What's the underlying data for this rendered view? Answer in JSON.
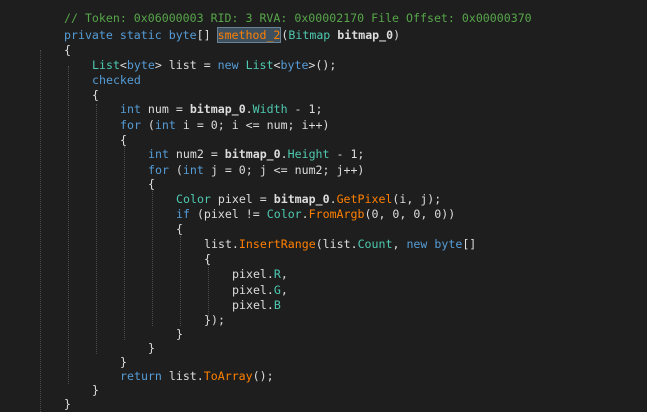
{
  "comment": "// Token: 0x06000003 RID: 3 RVA: 0x00002170 File Offset: 0x00000370",
  "sig": {
    "mods": "private static",
    "ret": "byte",
    "brackets": "[] ",
    "name": "smethod_2",
    "open": "(",
    "ptype": "Bitmap",
    "pname": "bitmap_0",
    "close": ")"
  },
  "b": {
    "open": "{",
    "close": "}",
    "close_paren": "});"
  },
  "l_list": {
    "t1": "List",
    "t2": "<",
    "t3": "byte",
    "t4": "> list = ",
    "k": "new",
    "t5": " ",
    "t6": "List",
    "t7": "<",
    "t8": "byte",
    "t9": ">();"
  },
  "checked": "checked",
  "l_num": {
    "k": "int",
    "a": " num = ",
    "p": "bitmap_0",
    "dot": ".",
    "prop": "Width",
    "rest": " - 1;"
  },
  "for1": {
    "k": "for",
    "a": " (",
    "k2": "int",
    "rest": " i = 0; i <= num; i++)"
  },
  "l_num2": {
    "k": "int",
    "a": " num2 = ",
    "p": "bitmap_0",
    "dot": ".",
    "prop": "Height",
    "rest": " - 1;"
  },
  "for2": {
    "k": "for",
    "a": " (",
    "k2": "int",
    "rest": " j = 0; j <= num2; j++)"
  },
  "l_pixel": {
    "t": "Color",
    "a": " pixel = ",
    "p": "bitmap_0",
    "dot": ".",
    "m": "GetPixel",
    "rest": "(i, j);"
  },
  "l_if": {
    "k": "if",
    "a": " (pixel != ",
    "t": "Color",
    "dot": ".",
    "m": "FromArgb",
    "rest": "(0, 0, 0, 0))"
  },
  "l_insert": {
    "a": "list.",
    "m": "InsertRange",
    "b": "(list.",
    "prop": "Count",
    "c": ", ",
    "k": "new",
    "d": " ",
    "k2": "byte",
    "e": "[]"
  },
  "l_r": {
    "a": "pixel.",
    "prop": "R",
    "c": ","
  },
  "l_g": {
    "a": "pixel.",
    "prop": "G",
    "c": ","
  },
  "l_bb": {
    "a": "pixel.",
    "prop": "B"
  },
  "l_return": {
    "k": "return",
    "a": " list.",
    "m": "ToArray",
    "rest": "();"
  }
}
